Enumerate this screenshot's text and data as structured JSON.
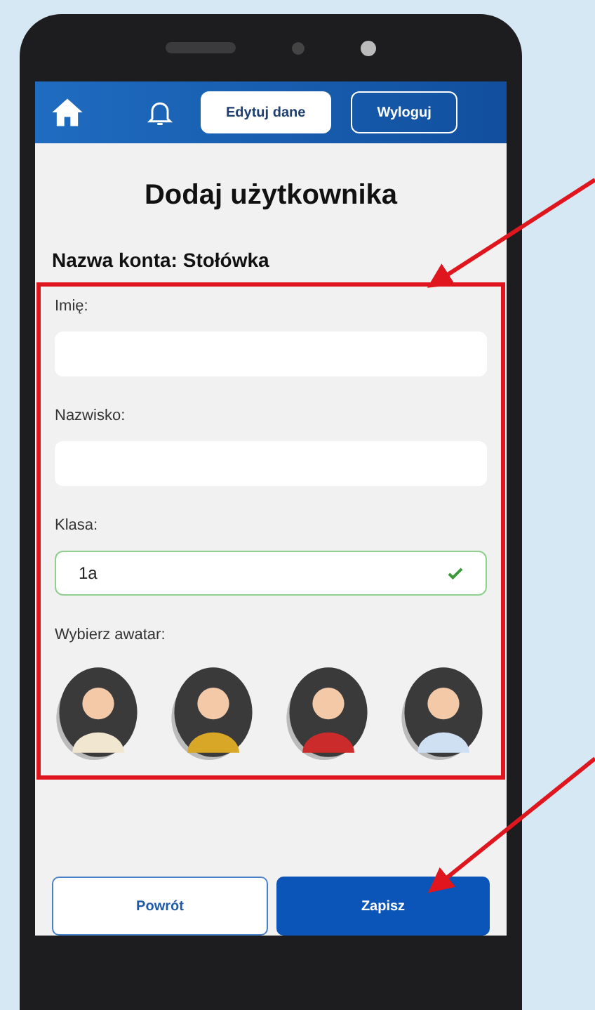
{
  "header": {
    "buttons": [
      {
        "label": "Edytuj dane",
        "kind": "filled"
      },
      {
        "label": "Wyloguj",
        "kind": "outline"
      }
    ]
  },
  "title": "Dodaj użytkownika",
  "account": "Nazwa konta: Stołówka",
  "fields": [
    {
      "label": "Imię:",
      "valid": false
    },
    {
      "label": "Nazwisko:",
      "valid": false
    },
    {
      "label": "Klasa:",
      "value": "1a",
      "valid": true
    }
  ],
  "avatar_label": "Wybierz awatar:",
  "actions": [
    {
      "label": "Powrót",
      "kind": "outline"
    },
    {
      "label": "Zapisz",
      "kind": "filled"
    }
  ]
}
